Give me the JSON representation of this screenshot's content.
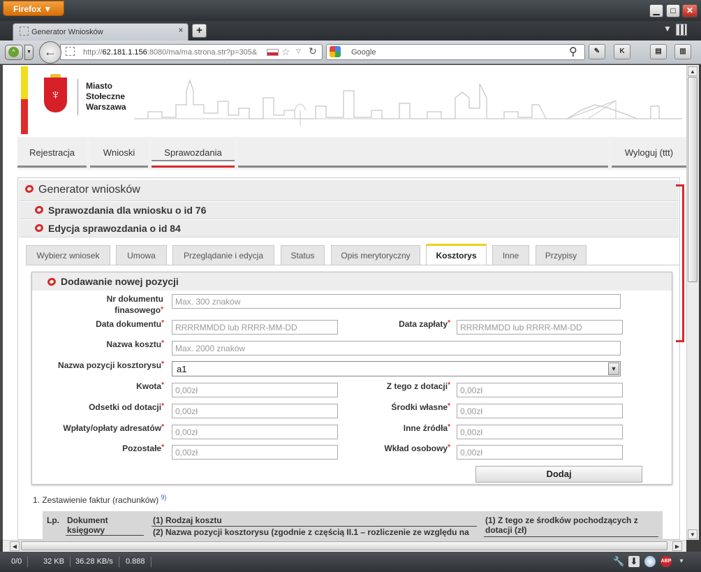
{
  "browser": {
    "app_button": "Firefox ▼",
    "tab_title": "Generator Wniosków",
    "new_tab": "+",
    "url_host": "62.181.1.156",
    "url_prefix": "http://",
    "url_rest": ":8080/ma/ma.strona.str?p=305&",
    "search_placeholder": "Google",
    "status": {
      "requests": "0/0",
      "size": "32 KB",
      "speed": "36.28 KB/s",
      "time": "0.888"
    }
  },
  "site": {
    "logo_lines": [
      "Miasto",
      "Stołeczne",
      "Warszawa"
    ],
    "nav": [
      {
        "label": "Rejestracja"
      },
      {
        "label": "Wnioski"
      },
      {
        "label": "Sprawozdania",
        "active": true
      },
      {
        "label": "Wyloguj (ttt)"
      }
    ]
  },
  "panel": {
    "title": "Generator wniosków",
    "subtitle1": "Sprawozdania dla wniosku o id 76",
    "subtitle2": "Edycja sprawozdania o id 84",
    "tabs": [
      "Wybierz wniosek",
      "Umowa",
      "Przeglądanie i edycja",
      "Status",
      "Opis merytoryczny",
      "Kosztorys",
      "Inne",
      "Przypisy"
    ],
    "active_tab": "Kosztorys"
  },
  "form": {
    "title": "Dodawanie nowej pozycji",
    "nr_dokumentu": {
      "label": "Nr dokumentu finasowego",
      "placeholder": "Max. 300 znaków"
    },
    "data_dokumentu": {
      "label": "Data dokumentu",
      "placeholder": "RRRRMMDD lub RRRR-MM-DD"
    },
    "data_zaplaty": {
      "label": "Data zapłaty",
      "placeholder": "RRRRMMDD lub RRRR-MM-DD"
    },
    "nazwa_kosztu": {
      "label": "Nazwa kosztu",
      "placeholder": "Max. 2000 znaków"
    },
    "nazwa_pozycji": {
      "label": "Nazwa pozycji kosztorysu",
      "value": "a1"
    },
    "kwota": {
      "label": "Kwota",
      "placeholder": "0,00zł"
    },
    "z_tego_dotacji": {
      "label": "Z tego z dotacji",
      "placeholder": "0,00zł"
    },
    "odsetki": {
      "label": "Odsetki od dotacji",
      "placeholder": "0,00zł"
    },
    "srodki_wlasne": {
      "label": "Środki własne",
      "placeholder": "0,00zł"
    },
    "wplaty": {
      "label": "Wpłaty/opłaty adresatów",
      "placeholder": "0,00zł"
    },
    "inne_zrodla": {
      "label": "Inne źródła",
      "placeholder": "0,00zł"
    },
    "pozostale": {
      "label": "Pozostałe",
      "placeholder": "0,00zł"
    },
    "wklad_osobowy": {
      "label": "Wkład osobowy",
      "placeholder": "0,00zł"
    },
    "submit": "Dodaj"
  },
  "invoices": {
    "title": "1. Zestawienie faktur (rachunków)",
    "footnote": "9)",
    "columns": {
      "lp": "Lp.",
      "dokument": "Dokument księgowy",
      "rodzaj": "(1) Rodzaj kosztu",
      "nazwa_poz": "(2) Nazwa pozycji kosztorysu (zgodnie z częścią II.1 – rozliczenie ze względu na",
      "z_tego": "(1) Z tego ze środków pochodzących z dotacji (zł)"
    }
  }
}
